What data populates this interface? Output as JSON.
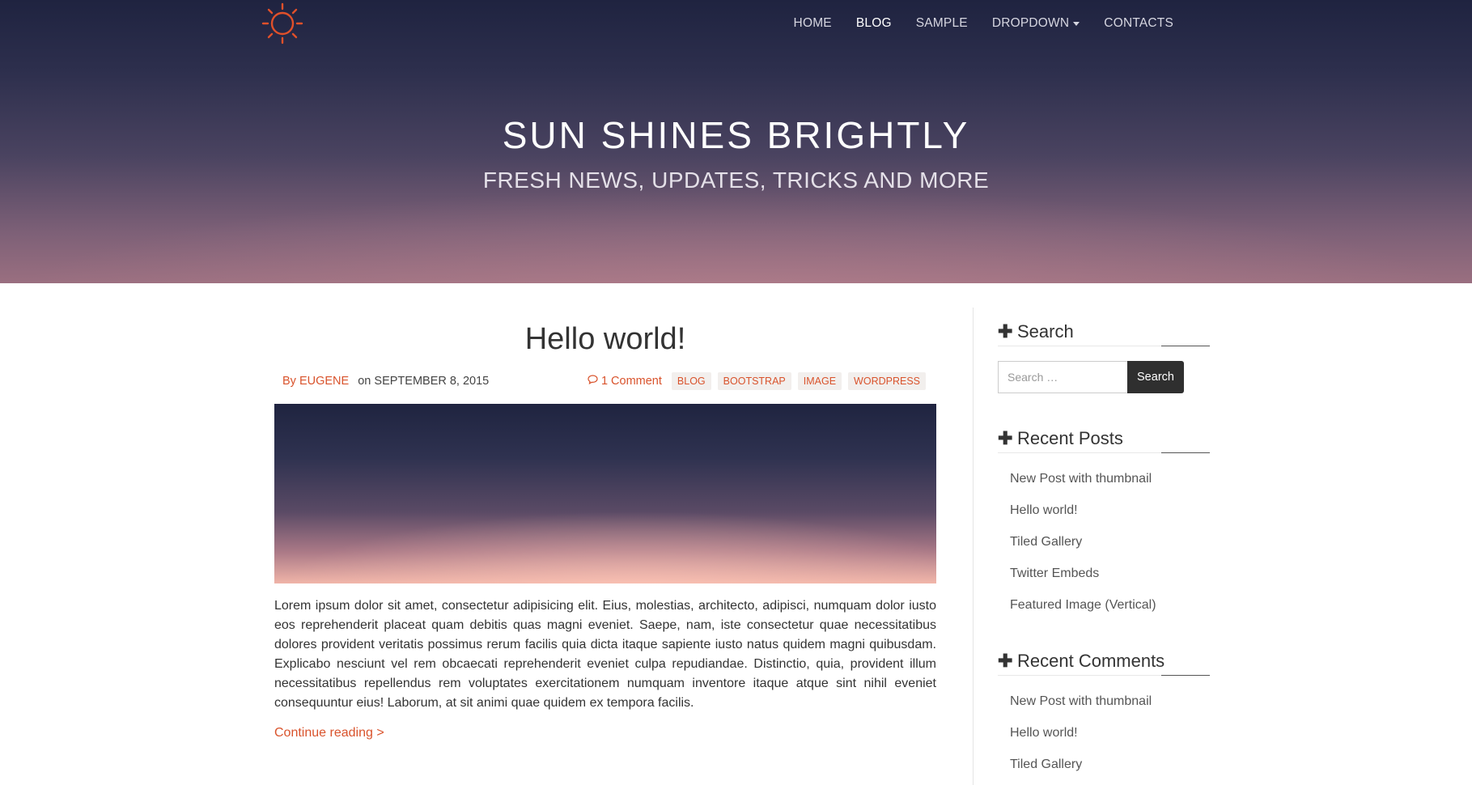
{
  "nav": {
    "items": [
      {
        "label": "HOME"
      },
      {
        "label": "BLOG"
      },
      {
        "label": "SAMPLE"
      },
      {
        "label": "DROPDOWN"
      },
      {
        "label": "CONTACTS"
      }
    ],
    "active": "BLOG"
  },
  "hero": {
    "title": "SUN SHINES BRIGHTLY",
    "subtitle": "FRESH NEWS, UPDATES, TRICKS AND MORE"
  },
  "post": {
    "title": "Hello world!",
    "author_prefix": "By",
    "author": "EUGENE",
    "date_prefix": "on",
    "date": "SEPTEMBER 8, 2015",
    "comments": "1 Comment",
    "tags": [
      "BLOG",
      "BOOTSTRAP",
      "IMAGE",
      "WORDPRESS"
    ],
    "excerpt": "Lorem ipsum dolor sit amet, consectetur adipisicing elit. Eius, molestias, architecto, adipisci, numquam dolor iusto eos reprehenderit placeat quam debitis quas magni eveniet. Saepe, nam, iste consectetur quae necessitatibus dolores provident veritatis possimus rerum facilis quia dicta itaque sapiente iusto natus quidem magni quibusdam. Explicabo nesciunt vel rem obcaecati reprehenderit eveniet culpa repudiandae. Distinctio, quia, provident illum necessitatibus repellendus rem voluptates exercitationem numquam inventore itaque atque sint nihil eveniet consequuntur eius! Laborum, at sit animi quae quidem ex tempora facilis.",
    "continue_label": "Continue reading >"
  },
  "sidebar": {
    "search": {
      "title": "Search",
      "placeholder": "Search …",
      "button_label": "Search"
    },
    "recent_posts": {
      "title": "Recent Posts",
      "items": [
        "New Post with thumbnail",
        "Hello world!",
        "Tiled Gallery",
        "Twitter Embeds",
        "Featured Image (Vertical)"
      ]
    },
    "recent_comments": {
      "title": "Recent Comments",
      "items": [
        "New Post with thumbnail",
        "Hello world!",
        "Tiled Gallery"
      ]
    }
  },
  "colors": {
    "accent": "#d9532c",
    "hero_top": "#1f2340",
    "hero_bottom": "#9a6f80",
    "search_button": "#2f2f2f"
  },
  "icons": {
    "logo": "sun-icon",
    "comment": "comment-bubble-icon",
    "widget": "plus-icon",
    "dropdown": "caret-down-icon"
  }
}
